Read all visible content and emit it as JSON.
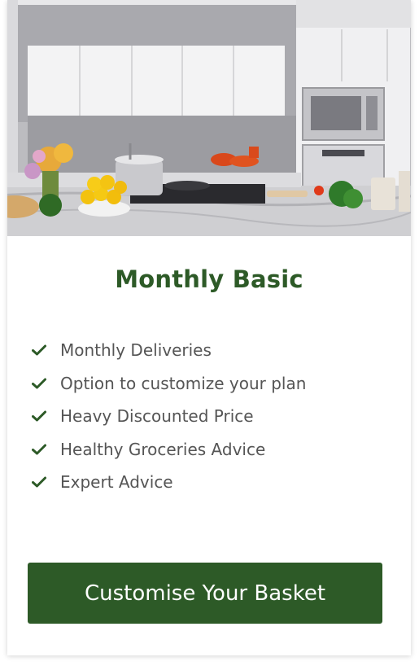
{
  "plan": {
    "title": "Monthly Basic",
    "features": [
      "Monthly Deliveries",
      "Option to customize your plan",
      "Heavy Discounted Price",
      "Healthy Groceries Advice",
      "Expert Advice"
    ],
    "cta_label": "Customise Your Basket",
    "hero_image": "kitchen-photo",
    "check_icon": "check-icon"
  },
  "colors": {
    "accent": "#2d5a27",
    "text": "#555555",
    "card_bg": "#ffffff"
  }
}
